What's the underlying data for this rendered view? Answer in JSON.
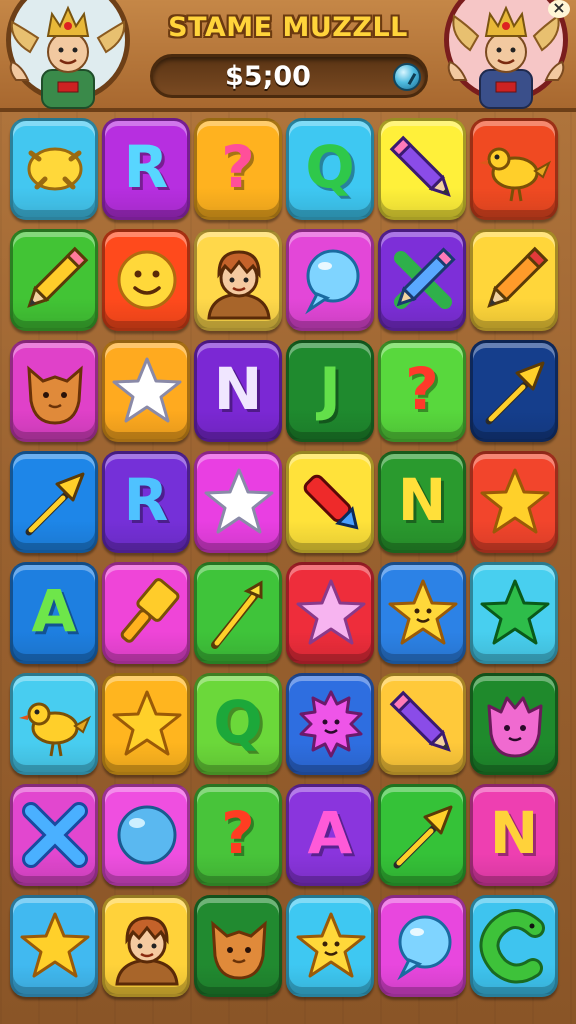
{
  "header": {
    "title": "STAME MUZZLL",
    "money": "$5;00",
    "left_avatar": "king-character",
    "right_avatar": "king-character",
    "close": "×"
  },
  "board": {
    "rows": 8,
    "cols": 6,
    "tiles": [
      {
        "kind": "icon",
        "icon": "lemon",
        "bg": "#43c7f0"
      },
      {
        "kind": "letter",
        "text": "R",
        "bg": "#b72fe0",
        "fg": "#58d6ff"
      },
      {
        "kind": "letter",
        "text": "?",
        "bg": "#ffb21f",
        "fg": "#ff4f9a"
      },
      {
        "kind": "letter",
        "text": "Q",
        "bg": "#3ec8f2",
        "fg": "#2fc84a"
      },
      {
        "kind": "icon",
        "icon": "pencil-purple",
        "bg": "#fff03a"
      },
      {
        "kind": "icon",
        "icon": "bird",
        "bg": "#f04a22"
      },
      {
        "kind": "icon",
        "icon": "pencil-yellow",
        "bg": "#42c435"
      },
      {
        "kind": "icon",
        "icon": "smiley",
        "bg": "#ff4a1c"
      },
      {
        "kind": "icon",
        "icon": "person",
        "bg": "#ffd84a"
      },
      {
        "kind": "icon",
        "icon": "bubble",
        "bg": "#e347d8"
      },
      {
        "kind": "icon",
        "icon": "x-pencil",
        "bg": "#7d2fd8"
      },
      {
        "kind": "icon",
        "icon": "pencil-orange",
        "bg": "#ffd63a"
      },
      {
        "kind": "icon",
        "icon": "cat",
        "bg": "#e041c9"
      },
      {
        "kind": "icon",
        "icon": "star-white",
        "bg": "#ffaa1f"
      },
      {
        "kind": "letter",
        "text": "N",
        "bg": "#7b28d4",
        "fg": "#f0e6ff"
      },
      {
        "kind": "letter",
        "text": "J",
        "bg": "#1f8a2e",
        "fg": "#63e04a"
      },
      {
        "kind": "letter",
        "text": "?",
        "bg": "#58d83d",
        "fg": "#ff3a2a"
      },
      {
        "kind": "icon",
        "icon": "arrow-yellow",
        "bg": "#153e8c"
      },
      {
        "kind": "icon",
        "icon": "arrow-yellow",
        "bg": "#1e86e8"
      },
      {
        "kind": "letter",
        "text": "R",
        "bg": "#7530d8",
        "fg": "#4fc2ff"
      },
      {
        "kind": "icon",
        "icon": "star-white",
        "bg": "#e93fe2"
      },
      {
        "kind": "icon",
        "icon": "crayon",
        "bg": "#ffe23a"
      },
      {
        "kind": "letter",
        "text": "N",
        "bg": "#2a9a2e",
        "fg": "#ffe03a"
      },
      {
        "kind": "icon",
        "icon": "star-yellow",
        "bg": "#f2452c"
      },
      {
        "kind": "letter",
        "text": "A",
        "bg": "#1e7fe0",
        "fg": "#6ee64a"
      },
      {
        "kind": "icon",
        "icon": "brush",
        "bg": "#ef45d8"
      },
      {
        "kind": "icon",
        "icon": "wand",
        "bg": "#3fc43a"
      },
      {
        "kind": "icon",
        "icon": "star-pink",
        "bg": "#ee2d3b"
      },
      {
        "kind": "icon",
        "icon": "star-smile",
        "bg": "#2c82e6"
      },
      {
        "kind": "icon",
        "icon": "star-green",
        "bg": "#48cfef"
      },
      {
        "kind": "icon",
        "icon": "bird",
        "bg": "#48cdf0"
      },
      {
        "kind": "icon",
        "icon": "star-yellow",
        "bg": "#ffb51f"
      },
      {
        "kind": "letter",
        "text": "Q",
        "bg": "#6bd83a",
        "fg": "#1ca83a"
      },
      {
        "kind": "icon",
        "icon": "sun-pink",
        "bg": "#2e6ee0"
      },
      {
        "kind": "icon",
        "icon": "pencil-purple",
        "bg": "#ffc93a"
      },
      {
        "kind": "icon",
        "icon": "blob-pink",
        "bg": "#1f8a2c"
      },
      {
        "kind": "icon",
        "icon": "x-blue",
        "bg": "#e247cf"
      },
      {
        "kind": "icon",
        "icon": "ball",
        "bg": "#ef4fe0"
      },
      {
        "kind": "letter",
        "text": "?",
        "bg": "#48c43a",
        "fg": "#ff3d22"
      },
      {
        "kind": "letter",
        "text": "A",
        "bg": "#8a35dd",
        "fg": "#ff5ad8"
      },
      {
        "kind": "icon",
        "icon": "arrow-yellow",
        "bg": "#35c238"
      },
      {
        "kind": "letter",
        "text": "N",
        "bg": "#ee3fb1",
        "fg": "#ffd23a"
      },
      {
        "kind": "icon",
        "icon": "star-yellow",
        "bg": "#41b9f0"
      },
      {
        "kind": "icon",
        "icon": "person",
        "bg": "#ffd23a"
      },
      {
        "kind": "icon",
        "icon": "cat",
        "bg": "#218a30"
      },
      {
        "kind": "icon",
        "icon": "star-smile",
        "bg": "#3ec8f2"
      },
      {
        "kind": "icon",
        "icon": "bubble",
        "bg": "#e847de"
      },
      {
        "kind": "icon",
        "icon": "worm",
        "bg": "#3ec4ef"
      }
    ]
  }
}
